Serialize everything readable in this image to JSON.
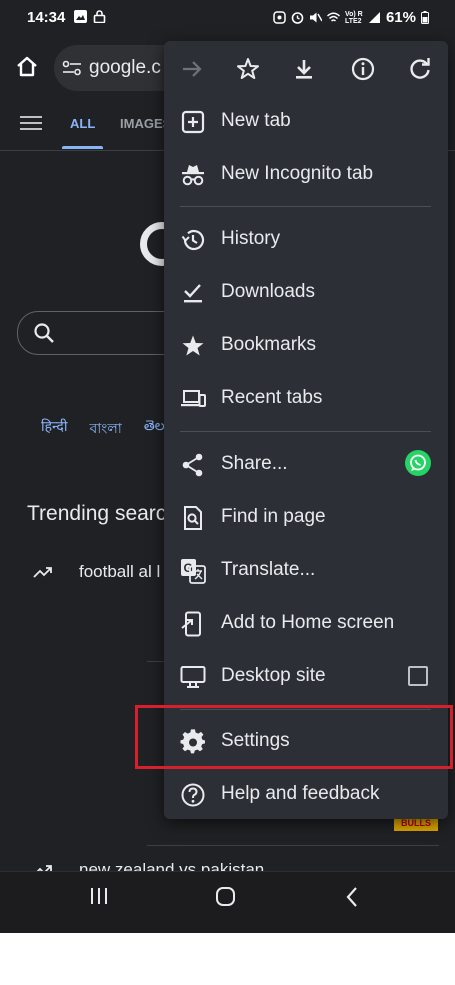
{
  "status_bar": {
    "time": "14:34",
    "battery": "61%",
    "network_label": "Vo) R LTE2"
  },
  "toolbar": {
    "url": "google.c"
  },
  "search_tabs": {
    "all": "ALL",
    "images": "IMAGES"
  },
  "languages": [
    "हिन्दी",
    "বাংলা",
    "తెల"
  ],
  "trending": {
    "heading": "Trending searc",
    "items": [
      "football al l",
      "new zealand vs pakistan"
    ]
  },
  "thumbnail_text": "BULLS",
  "menu": {
    "top_icons": [
      "forward-icon",
      "star-icon",
      "download-icon",
      "info-icon",
      "refresh-icon"
    ],
    "group1": [
      {
        "label": "New tab",
        "icon": "new-tab-icon"
      },
      {
        "label": "New Incognito tab",
        "icon": "incognito-icon"
      }
    ],
    "group2": [
      {
        "label": "History",
        "icon": "history-icon"
      },
      {
        "label": "Downloads",
        "icon": "downloads-icon"
      },
      {
        "label": "Bookmarks",
        "icon": "bookmarks-icon"
      },
      {
        "label": "Recent tabs",
        "icon": "recent-tabs-icon"
      }
    ],
    "group3": [
      {
        "label": "Share...",
        "icon": "share-icon"
      },
      {
        "label": "Find in page",
        "icon": "find-in-page-icon"
      },
      {
        "label": "Translate...",
        "icon": "translate-icon"
      },
      {
        "label": "Add to Home screen",
        "icon": "add-to-home-icon"
      },
      {
        "label": "Desktop site",
        "icon": "desktop-icon"
      }
    ],
    "group4": [
      {
        "label": "Settings",
        "icon": "settings-icon"
      },
      {
        "label": "Help and feedback",
        "icon": "help-icon"
      }
    ],
    "desktop_site_checked": false,
    "highlight_color": "#d6202c",
    "whatsapp_color": "#25d366"
  },
  "colors": {
    "background": "#202124",
    "menu_bg": "#2c3036",
    "link": "#8ab4f8"
  }
}
